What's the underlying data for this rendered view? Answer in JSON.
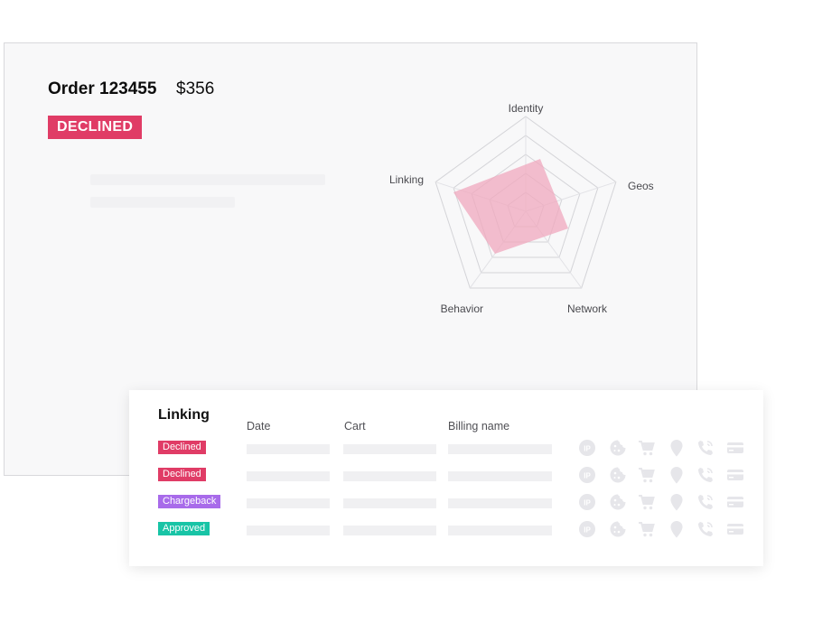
{
  "order": {
    "title": "Order 123455",
    "amount": "$356",
    "status": "DECLINED",
    "status_color": "#e03c66"
  },
  "radar": {
    "axes": [
      "Identity",
      "Geos",
      "Network",
      "Behavior",
      "Linking"
    ],
    "levels": 5,
    "fill_color": "#f0a8bd"
  },
  "linking": {
    "title": "Linking",
    "columns": [
      "Date",
      "Cart",
      "Billing name"
    ],
    "rows": [
      {
        "status": "Declined",
        "color": "#e03c66"
      },
      {
        "status": "Declined",
        "color": "#e03c66"
      },
      {
        "status": "Chargeback",
        "color": "#a86bea"
      },
      {
        "status": "Approved",
        "color": "#18c4a6"
      }
    ],
    "icons": [
      "ip-icon",
      "cookie-icon",
      "cart-icon",
      "location-pin-icon",
      "phone-icon",
      "credit-card-icon"
    ],
    "ip_label": "IP"
  }
}
